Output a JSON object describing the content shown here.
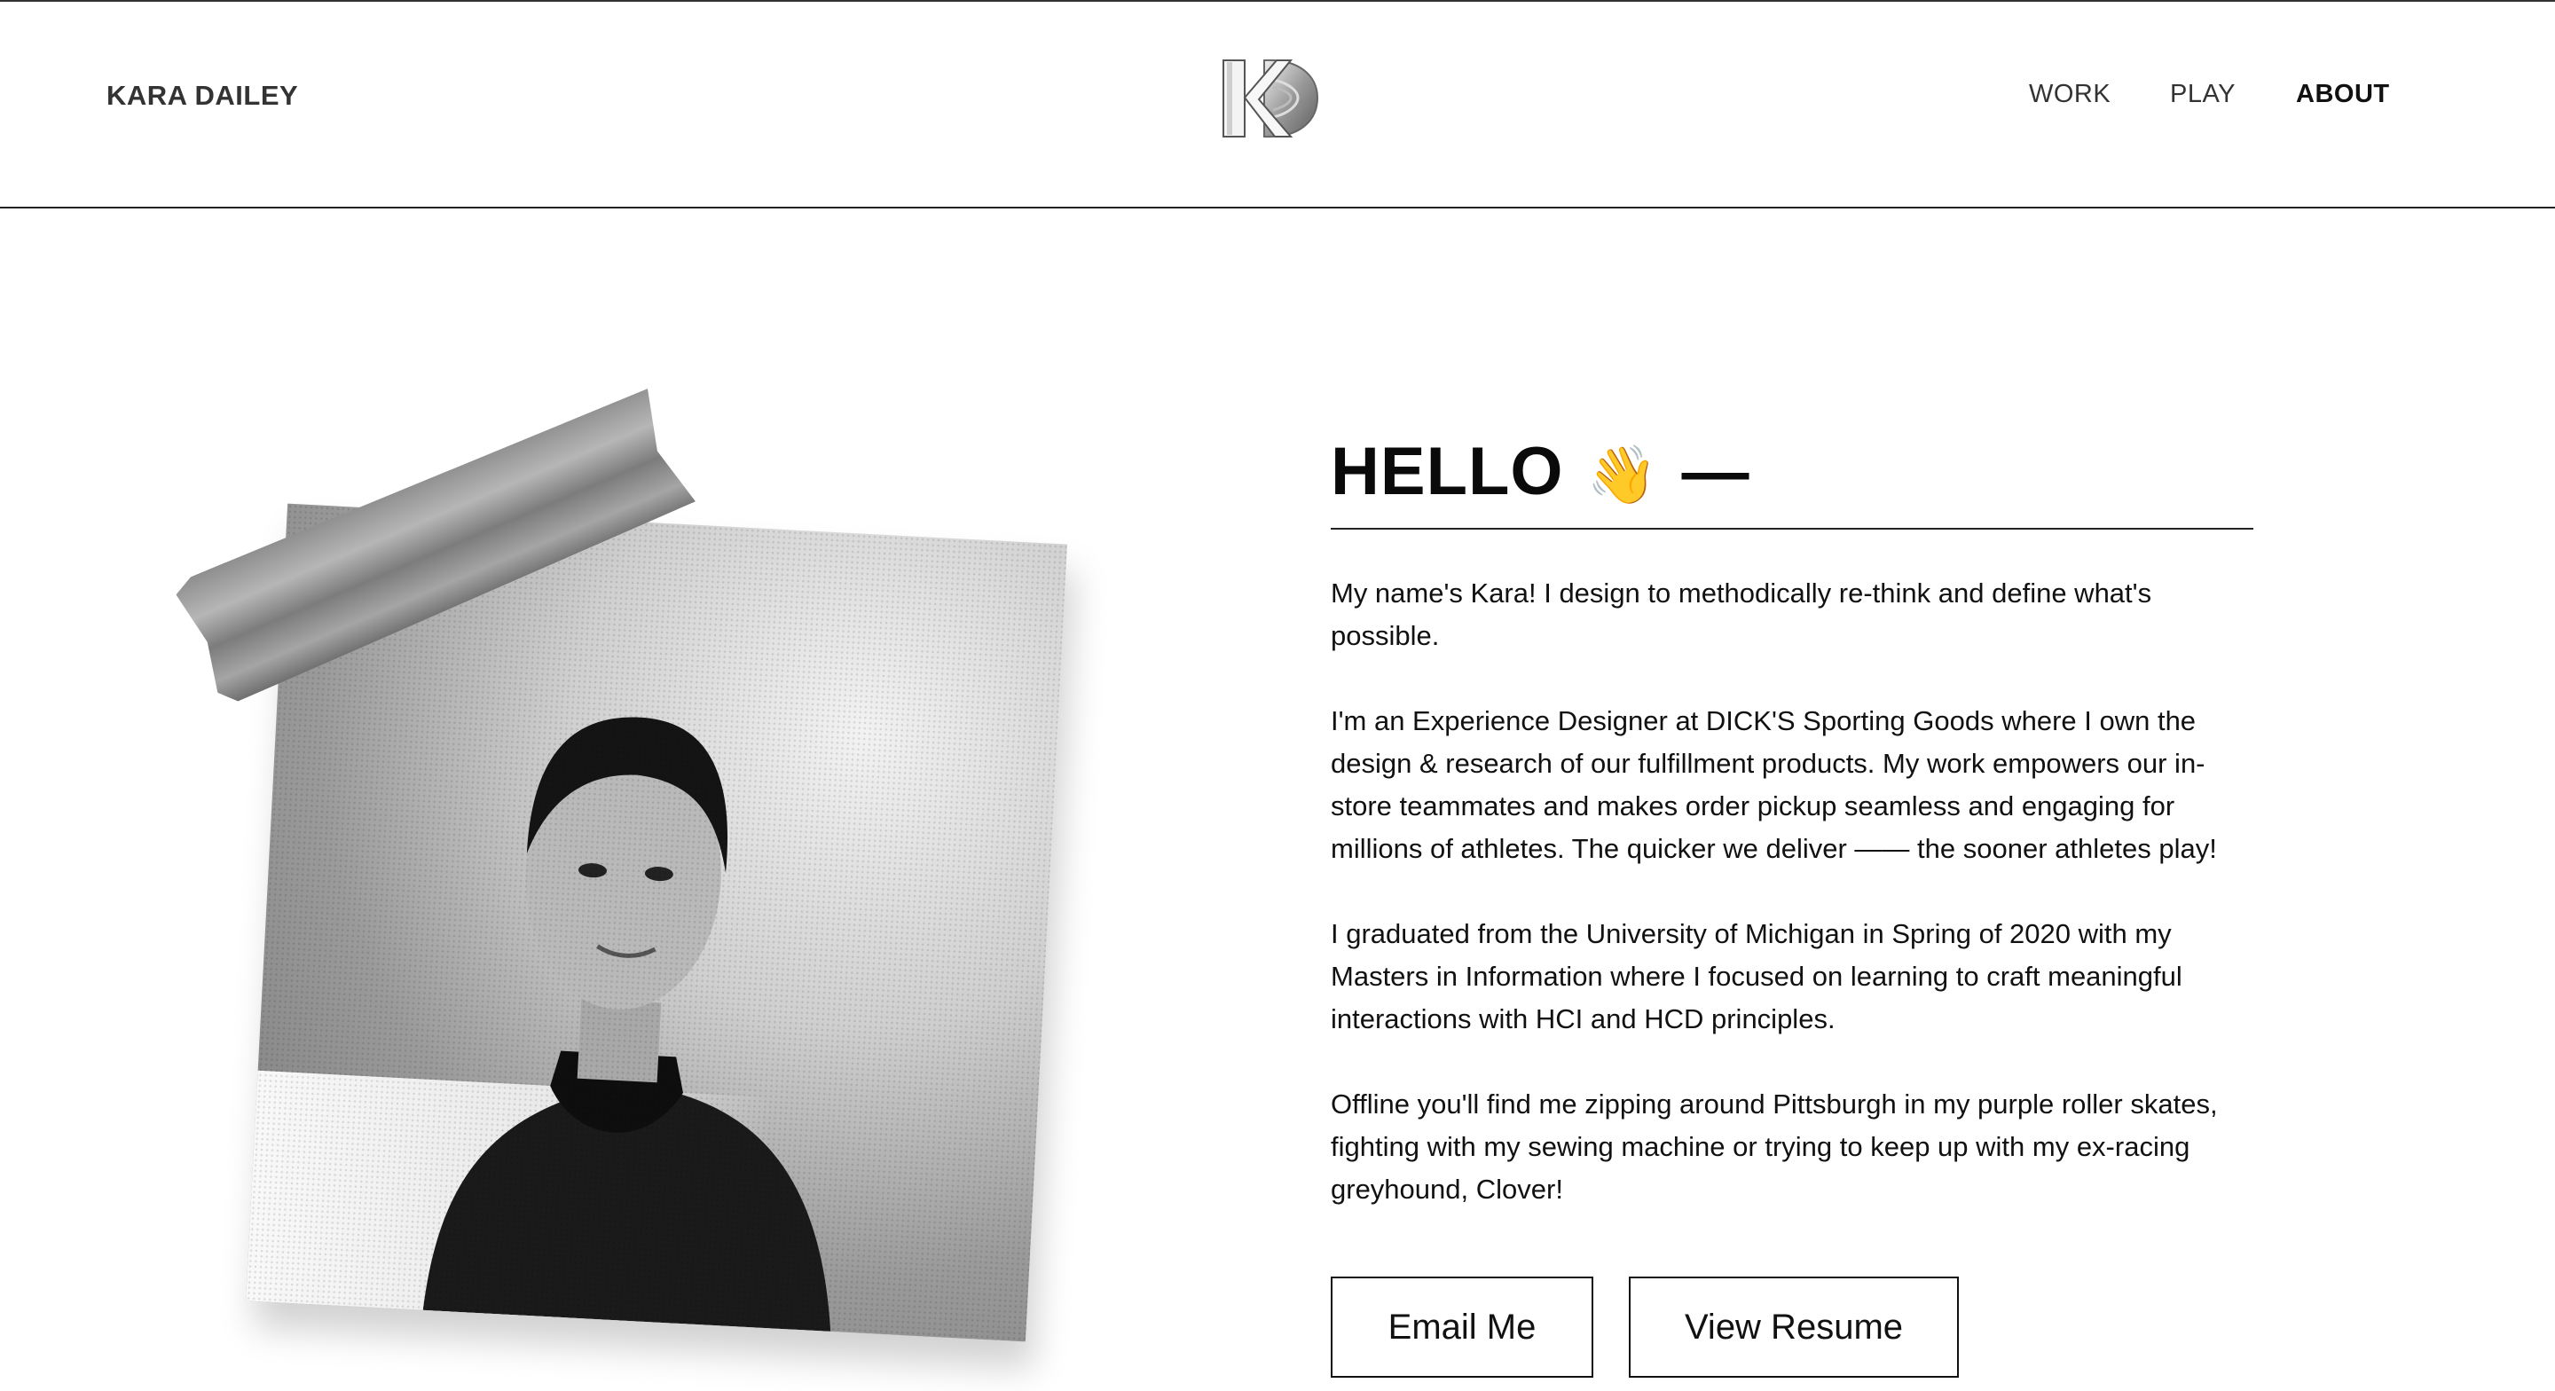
{
  "header": {
    "brand": "KARA DAILEY",
    "logo_icon": "kd-monogram-logo",
    "nav": [
      {
        "label": "WORK",
        "active": false
      },
      {
        "label": "PLAY",
        "active": false
      },
      {
        "label": "ABOUT",
        "active": true
      }
    ]
  },
  "photo": {
    "icon": "portrait-photo",
    "tape_icon": "duct-tape"
  },
  "about": {
    "heading": "HELLO",
    "heading_emoji": "👋",
    "heading_dash": "—",
    "paragraphs": [
      "My name's Kara! I design to methodically re-think and define what's possible.",
      "I'm an Experience Designer at DICK'S Sporting Goods where I own the design & research of our fulfillment products. My work empowers our in-store teammates and makes order pickup seamless and engaging for millions of athletes. The quicker we deliver —— the sooner athletes play!",
      "I graduated from the University of Michigan in Spring of 2020 with my Masters in Information where I focused on learning to craft meaningful interactions with HCI and HCD principles.",
      "Offline you'll find me zipping around Pittsburgh in my purple roller skates, fighting with my sewing machine or trying to keep up with my ex-racing greyhound, Clover!"
    ],
    "buttons": {
      "email": "Email Me",
      "resume": "View Resume"
    }
  }
}
